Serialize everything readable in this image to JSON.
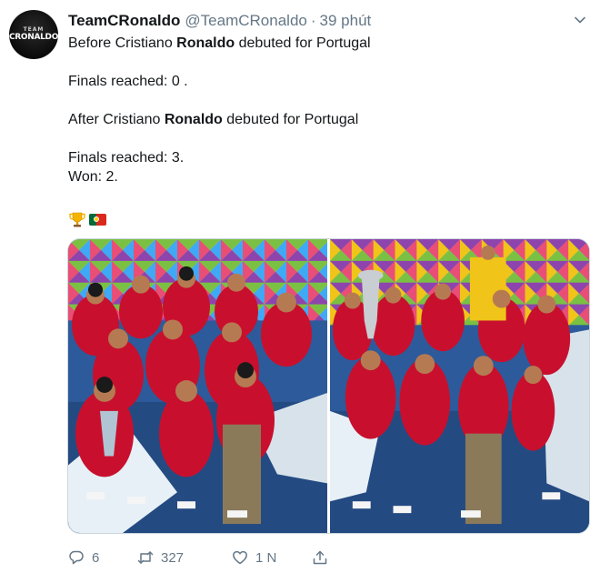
{
  "tweet": {
    "avatar": {
      "top_text": "TEAM",
      "main_text": "CRONALDO"
    },
    "display_name": "TeamCRonaldo",
    "handle": "@TeamCRonaldo",
    "separator": "·",
    "time": "39 phút",
    "lines": [
      {
        "before": "Before Cristiano ",
        "bold": "Ronaldo",
        "after": " debuted for Portugal"
      },
      {
        "text": "Finals reached: 0 ."
      },
      {
        "before": "After Cristiano ",
        "bold": "Ronaldo",
        "after": " debuted for Portugal"
      },
      {
        "text": "Finals reached: 3."
      },
      {
        "text": "Won: 2."
      }
    ],
    "emojis": [
      "trophy-icon",
      "portugal-flag-icon"
    ],
    "media": [
      "team-celebration-photo-1",
      "team-celebration-photo-2"
    ],
    "actions": {
      "reply_count": "6",
      "retweet_count": "327",
      "like_count": "1 N",
      "share_count": ""
    },
    "colors": {
      "text": "#14171a",
      "secondary": "#657786",
      "jersey_red": "#c8102e",
      "field_blue": "#2d5a9a"
    }
  }
}
